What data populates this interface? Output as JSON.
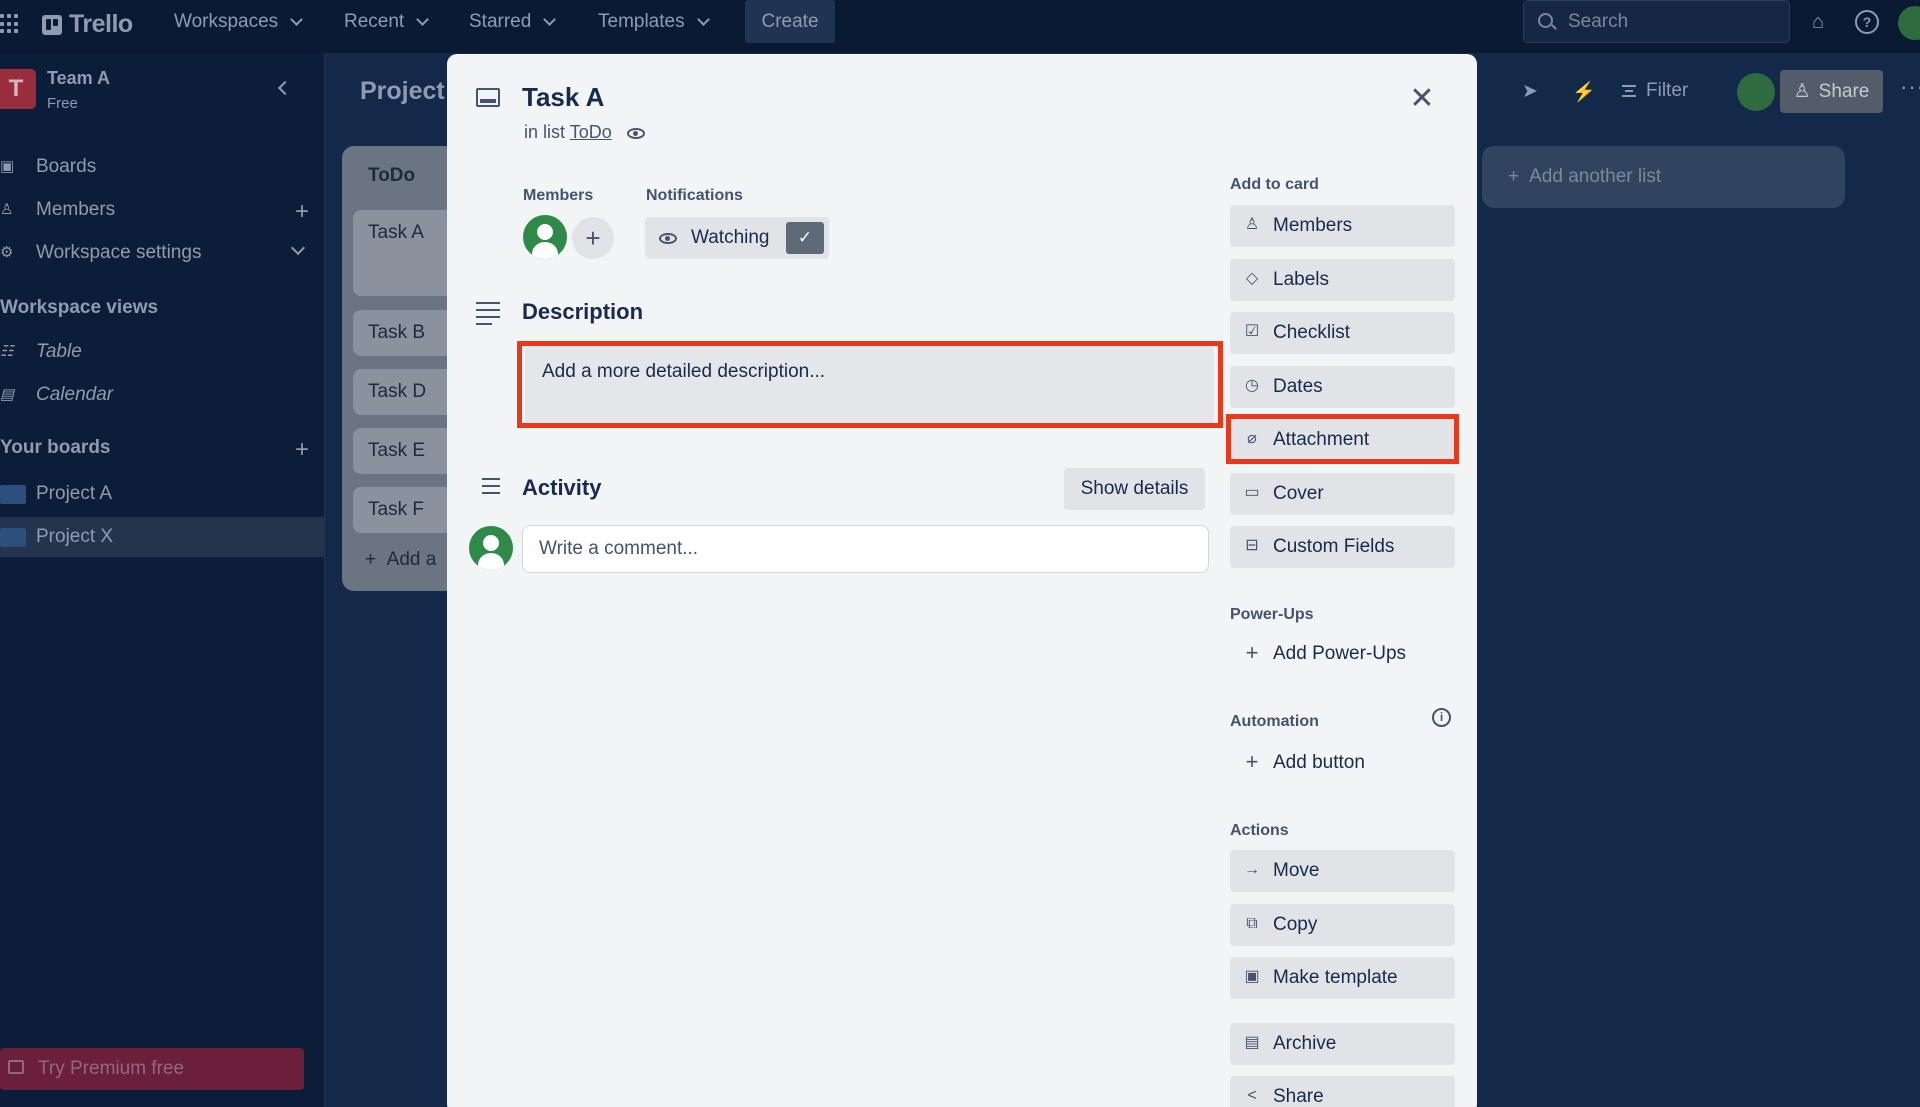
{
  "topnav": {
    "logo": "Trello",
    "menus": [
      "Workspaces",
      "Recent",
      "Starred",
      "Templates"
    ],
    "create_label": "Create",
    "search_placeholder": "Search"
  },
  "sidebar": {
    "team_initial": "T",
    "team_name": "Team A",
    "team_plan": "Free",
    "items": [
      {
        "label": "Boards"
      },
      {
        "label": "Members"
      },
      {
        "label": "Workspace settings"
      }
    ],
    "views_heading": "Workspace views",
    "views": [
      {
        "label": "Table"
      },
      {
        "label": "Calendar"
      }
    ],
    "boards_heading": "Your boards",
    "boards": [
      {
        "label": "Project A"
      },
      {
        "label": "Project X"
      }
    ],
    "premium_label": "Try Premium free"
  },
  "board": {
    "title": "Project",
    "list_title": "ToDo",
    "cards": [
      "Task A",
      "Task B",
      "Task D",
      "Task E",
      "Task F"
    ],
    "add_card": "Add a",
    "filter_label": "Filter",
    "share_label": "Share",
    "add_list_label": "Add another list"
  },
  "modal": {
    "title": "Task A",
    "in_list_prefix": "in list",
    "list_name": "ToDo",
    "members_label": "Members",
    "notifications_label": "Notifications",
    "watching_label": "Watching",
    "description_title": "Description",
    "description_placeholder": "Add a more detailed description...",
    "activity_title": "Activity",
    "show_details_label": "Show details",
    "comment_placeholder": "Write a comment...",
    "add_to_card_label": "Add to card",
    "add_to_card": [
      {
        "label": "Members",
        "icon": "person-icon"
      },
      {
        "label": "Labels",
        "icon": "tag-icon"
      },
      {
        "label": "Checklist",
        "icon": "checklist-icon"
      },
      {
        "label": "Dates",
        "icon": "clock-icon"
      },
      {
        "label": "Attachment",
        "icon": "paperclip-icon"
      },
      {
        "label": "Cover",
        "icon": "cover-icon"
      },
      {
        "label": "Custom Fields",
        "icon": "custom-fields-icon"
      }
    ],
    "powerups_label": "Power-Ups",
    "add_powerups_label": "Add Power-Ups",
    "automation_label": "Automation",
    "add_button_label": "Add button",
    "actions_label": "Actions",
    "actions": [
      {
        "label": "Move",
        "icon": "arrow-right-icon"
      },
      {
        "label": "Copy",
        "icon": "copy-icon"
      },
      {
        "label": "Make template",
        "icon": "template-icon"
      },
      {
        "label": "Archive",
        "icon": "archive-icon"
      },
      {
        "label": "Share",
        "icon": "share-icon"
      }
    ]
  },
  "colors": {
    "highlight": "#e8391f",
    "modal_bg": "#f3f4f6",
    "avatar_green": "#2f8a4a"
  }
}
